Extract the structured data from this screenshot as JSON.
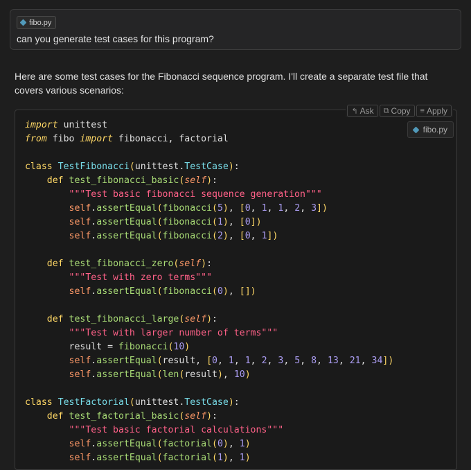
{
  "user_message": {
    "file_chip": "fibo.py",
    "text": "can you generate test cases for this program?"
  },
  "assistant": {
    "text": "Here are some test cases for the Fibonacci sequence program. I'll create a separate test file that covers various scenarios:"
  },
  "code_block": {
    "toolbar": {
      "ask_label": "Ask",
      "copy_label": "Copy",
      "apply_label": "Apply"
    },
    "file_chip": "fibo.py"
  },
  "colors": {
    "background": "#1e1e1e",
    "python_icon": "#519aba",
    "keyword": "#ffd866",
    "class_name": "#78dce8",
    "function": "#a9dc76",
    "self": "#fc9867",
    "string": "#ff6188",
    "number": "#ab9df2"
  }
}
